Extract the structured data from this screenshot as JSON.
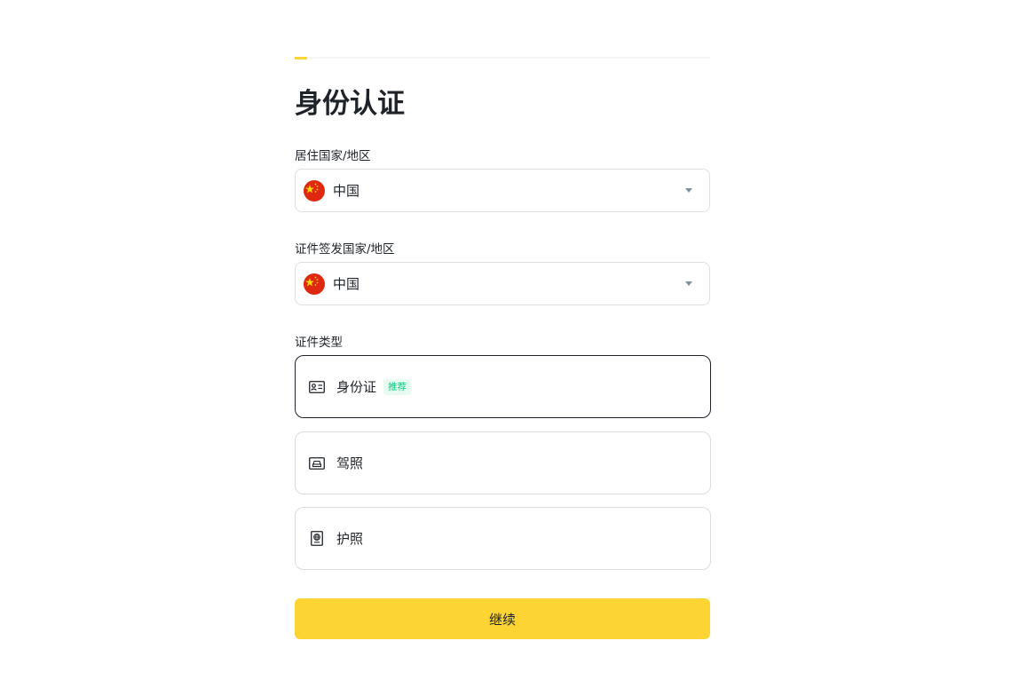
{
  "page": {
    "title": "身份认证",
    "progress_fraction": 0.03
  },
  "residence": {
    "label": "居住国家/地区",
    "value": "中国",
    "flag_icon": "china-flag-icon"
  },
  "issuing": {
    "label": "证件签发国家/地区",
    "value": "中国",
    "flag_icon": "china-flag-icon"
  },
  "doc_type": {
    "label": "证件类型",
    "options": [
      {
        "label": "身份证",
        "badge": "推荐",
        "icon": "id-card-icon",
        "selected": true
      },
      {
        "label": "驾照",
        "badge": "",
        "icon": "driver-license-icon",
        "selected": false
      },
      {
        "label": "护照",
        "badge": "",
        "icon": "passport-icon",
        "selected": false
      }
    ]
  },
  "actions": {
    "continue_label": "继续"
  },
  "colors": {
    "accent": "#fcd535",
    "text": "#1e2329",
    "badge_text": "#0ecb81",
    "badge_bg": "#e8fbf3",
    "border": "#e0e0e0",
    "flag_red": "#de2910",
    "flag_yellow": "#ffde00"
  }
}
